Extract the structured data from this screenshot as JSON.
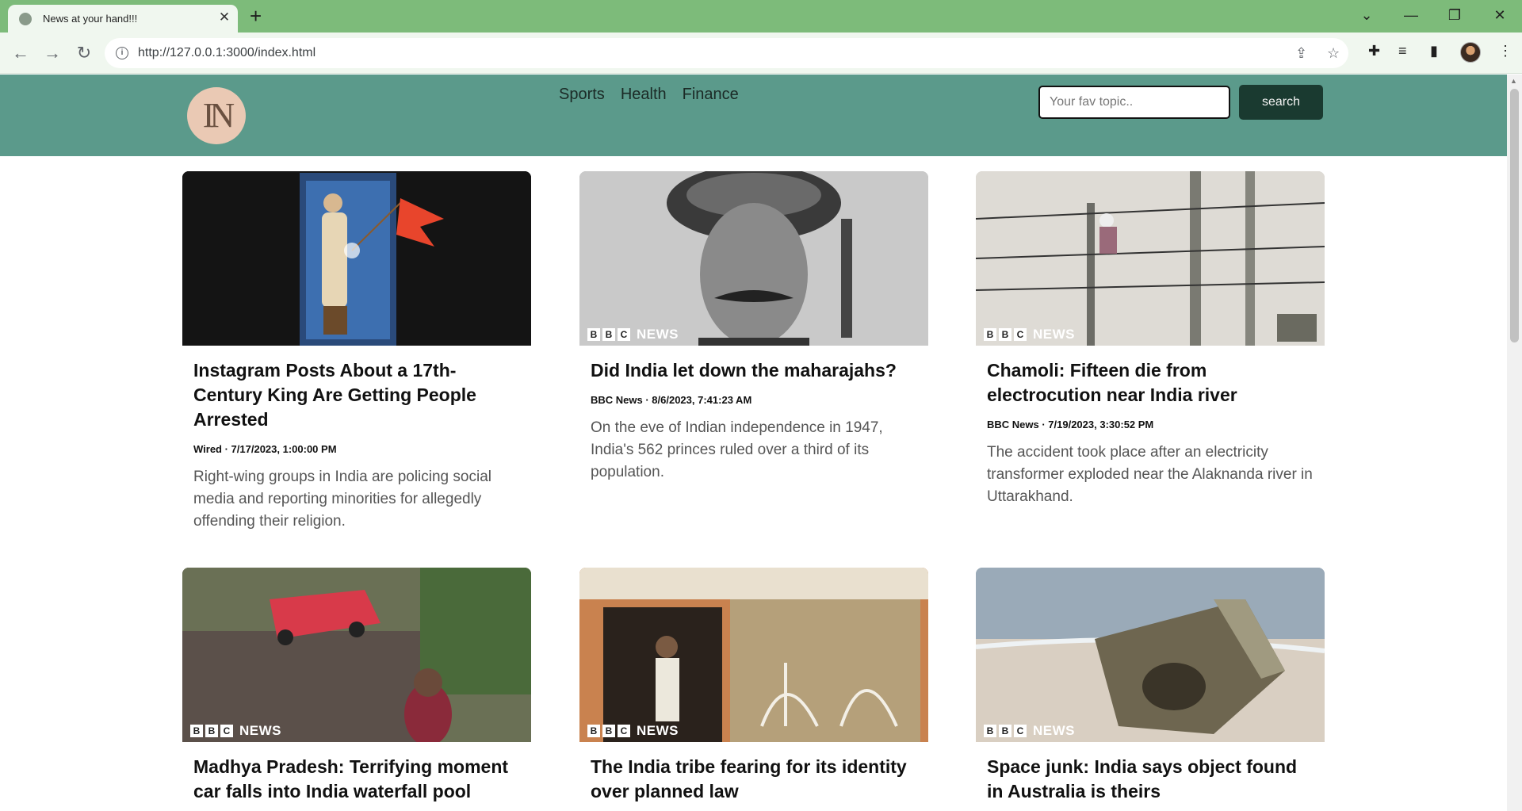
{
  "browser": {
    "tab_title": "News at your hand!!!",
    "tab_close": "✕",
    "new_tab": "+",
    "url": "http://127.0.0.1:3000/index.html"
  },
  "site": {
    "logo_text": "IN",
    "nav": [
      "Sports",
      "Health",
      "Finance"
    ],
    "search_placeholder": "Your fav topic..",
    "search_label": "search"
  },
  "articles": [
    {
      "title": "Instagram Posts About a 17th-Century King Are Getting People Arrested",
      "meta": "Wired · 7/17/2023, 1:00:00 PM",
      "description": "Right-wing groups in India are policing social media and reporting minorities for allegedly offending their religion."
    },
    {
      "title": "Did India let down the maharajahs?",
      "meta": "BBC News · 8/6/2023, 7:41:23 AM",
      "description": "On the eve of Indian independence in 1947, India's 562 princes ruled over a third of its population."
    },
    {
      "title": "Chamoli: Fifteen die from electrocution near India river",
      "meta": "BBC News · 7/19/2023, 3:30:52 PM",
      "description": "The accident took place after an electricity transformer exploded near the Alaknanda river in Uttarakhand."
    },
    {
      "title": "Madhya Pradesh: Terrifying moment car falls into India waterfall pool",
      "meta": "",
      "description": ""
    },
    {
      "title": "The India tribe fearing for its identity over planned law",
      "meta": "",
      "description": ""
    },
    {
      "title": "Space junk: India says object found in Australia is theirs",
      "meta": "",
      "description": ""
    }
  ],
  "bbc_watermark": {
    "letters": [
      "B",
      "B",
      "C"
    ],
    "word": "NEWS"
  },
  "colors": {
    "tab_strip": "#7dbb7a",
    "site_header": "#5b9a8b",
    "search_button": "#1a3a30"
  }
}
